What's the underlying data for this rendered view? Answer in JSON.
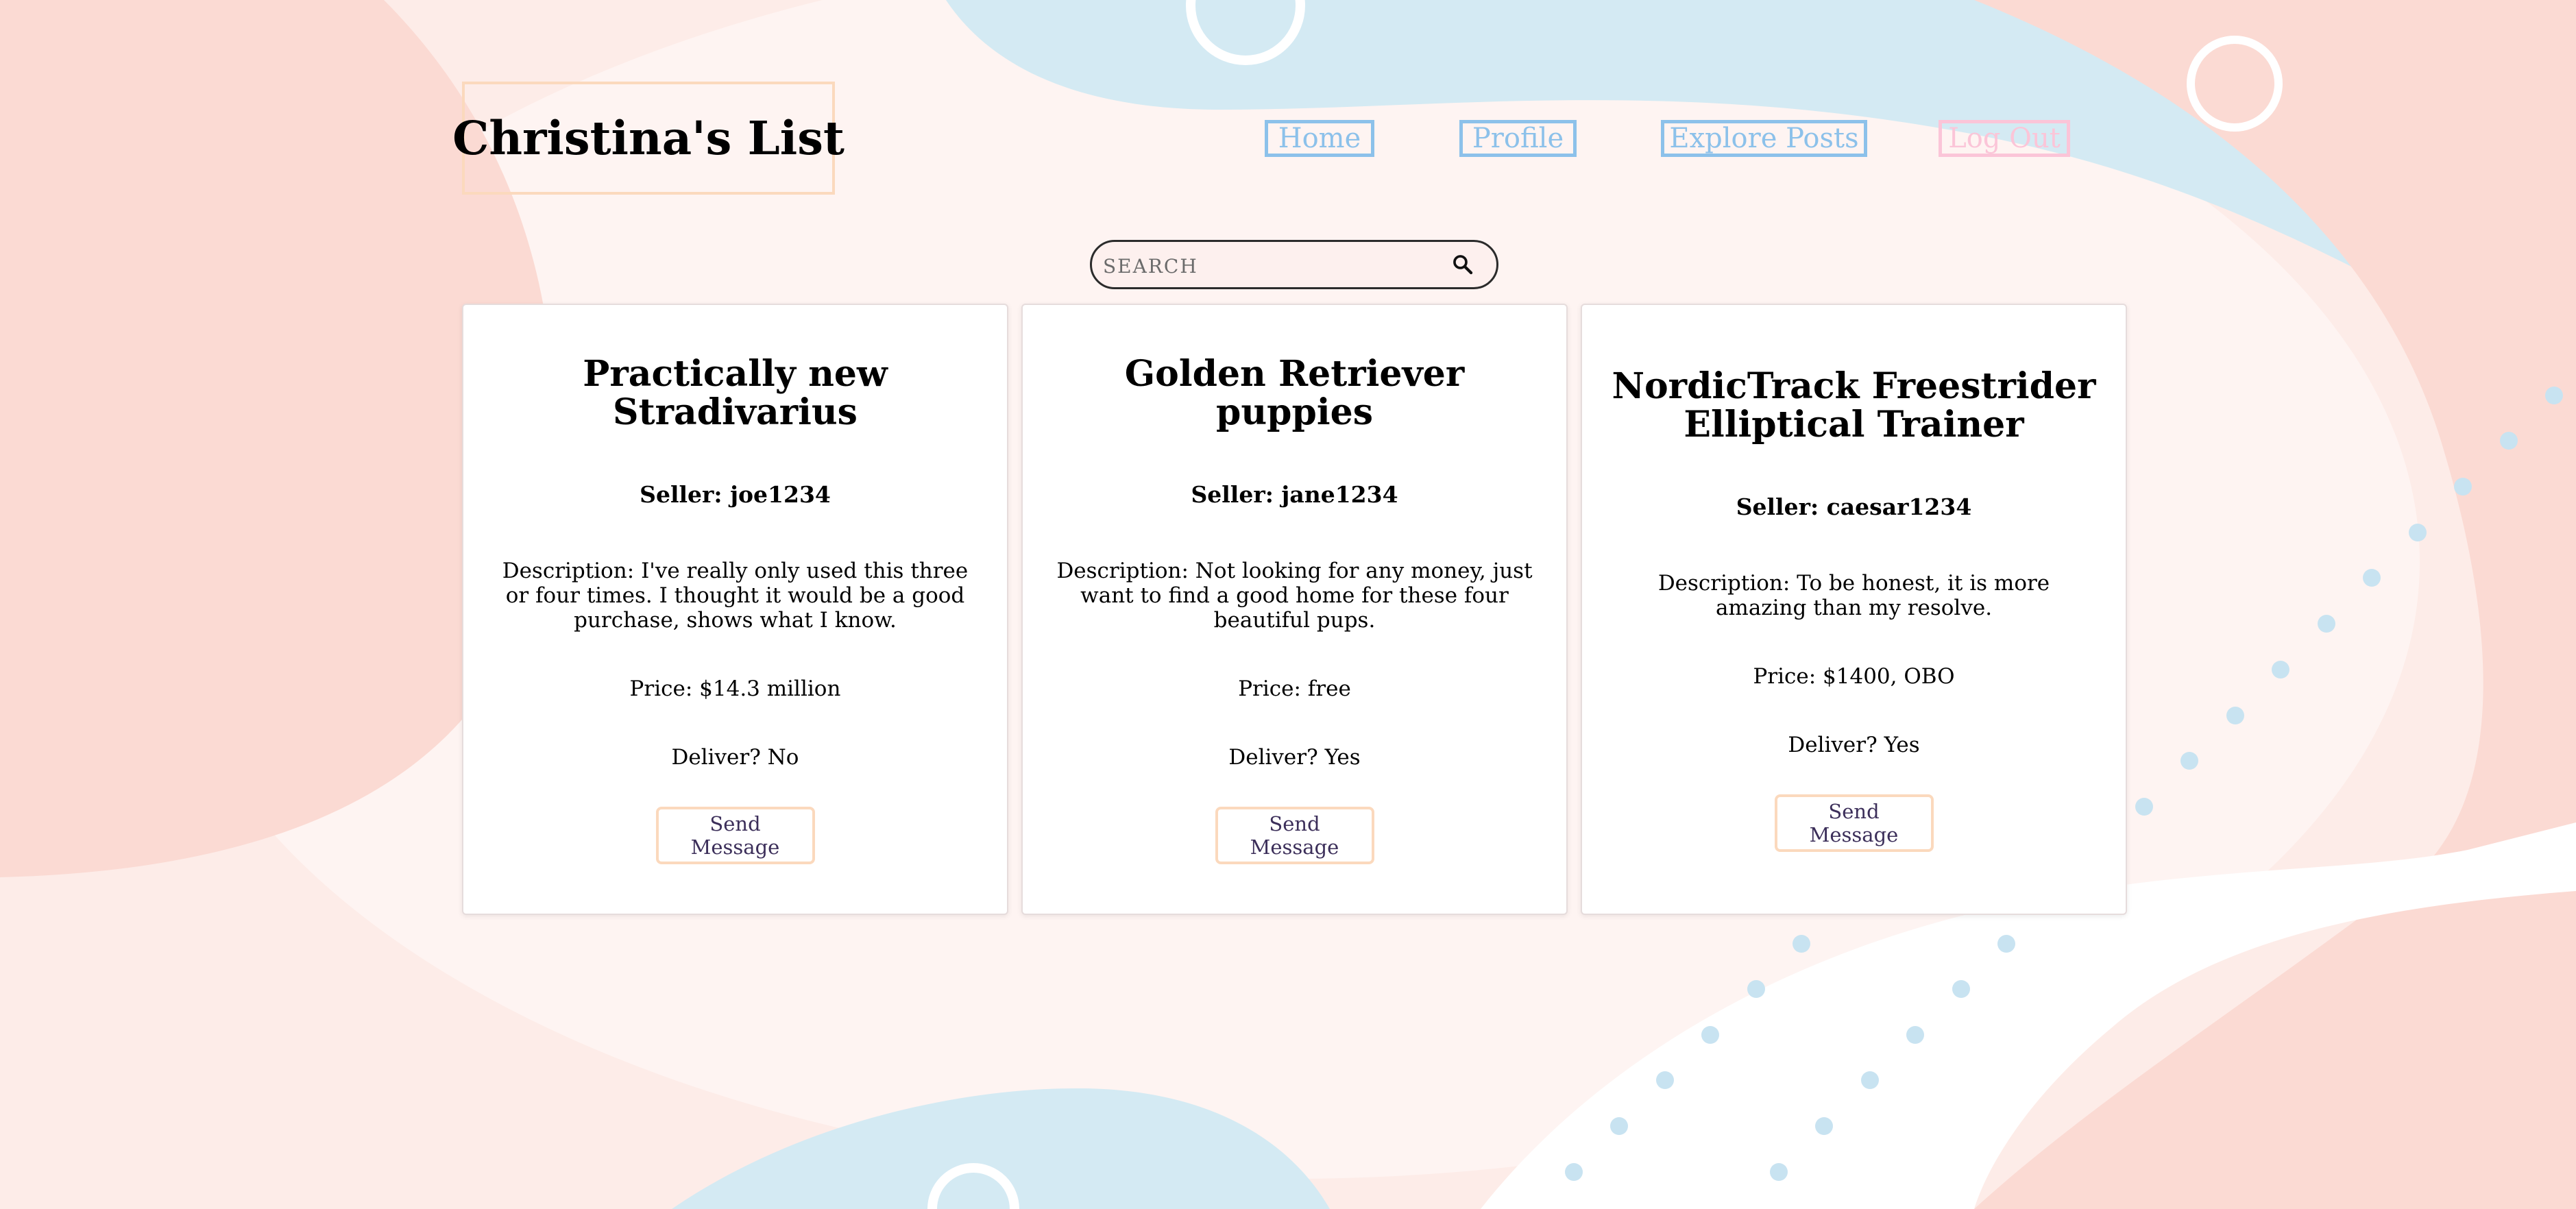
{
  "header": {
    "title": "Christina's List"
  },
  "nav": {
    "items": [
      {
        "label": "Home"
      },
      {
        "label": "Profile"
      },
      {
        "label": "Explore Posts"
      },
      {
        "label": "Log Out"
      }
    ]
  },
  "search": {
    "placeholder": "SEARCH",
    "value": "",
    "icon": "search-icon"
  },
  "posts": [
    {
      "title": "Practically new Stradivarius",
      "seller": "Seller: joe1234",
      "description": "Description: I've really only used this three or four times. I thought it would be a good purchase, shows what I know.",
      "price": "Price: $14.3 million",
      "deliver": "Deliver? No",
      "button_label": "Send Message"
    },
    {
      "title": "Golden Retriever puppies",
      "seller": "Seller: jane1234",
      "description": "Description: Not looking for any money, just want to find a good home for these four beautiful pups.",
      "price": "Price: free",
      "deliver": "Deliver? Yes",
      "button_label": "Send Message"
    },
    {
      "title": "NordicTrack Freestrider Elliptical Trainer",
      "seller": "Seller: caesar1234",
      "description": "Description: To be honest, it is more amazing than my resolve.",
      "price": "Price: $1400, OBO",
      "deliver": "Deliver? Yes",
      "button_label": "Send Message"
    }
  ],
  "colors": {
    "background_peach": "#fdece8",
    "blob_blue": "#d4eaf3",
    "blob_pink": "#fbdad3",
    "nav_blue": "#8cc1ea",
    "nav_pink": "#fbc5d8",
    "accent_peach": "#fbd9bd"
  }
}
